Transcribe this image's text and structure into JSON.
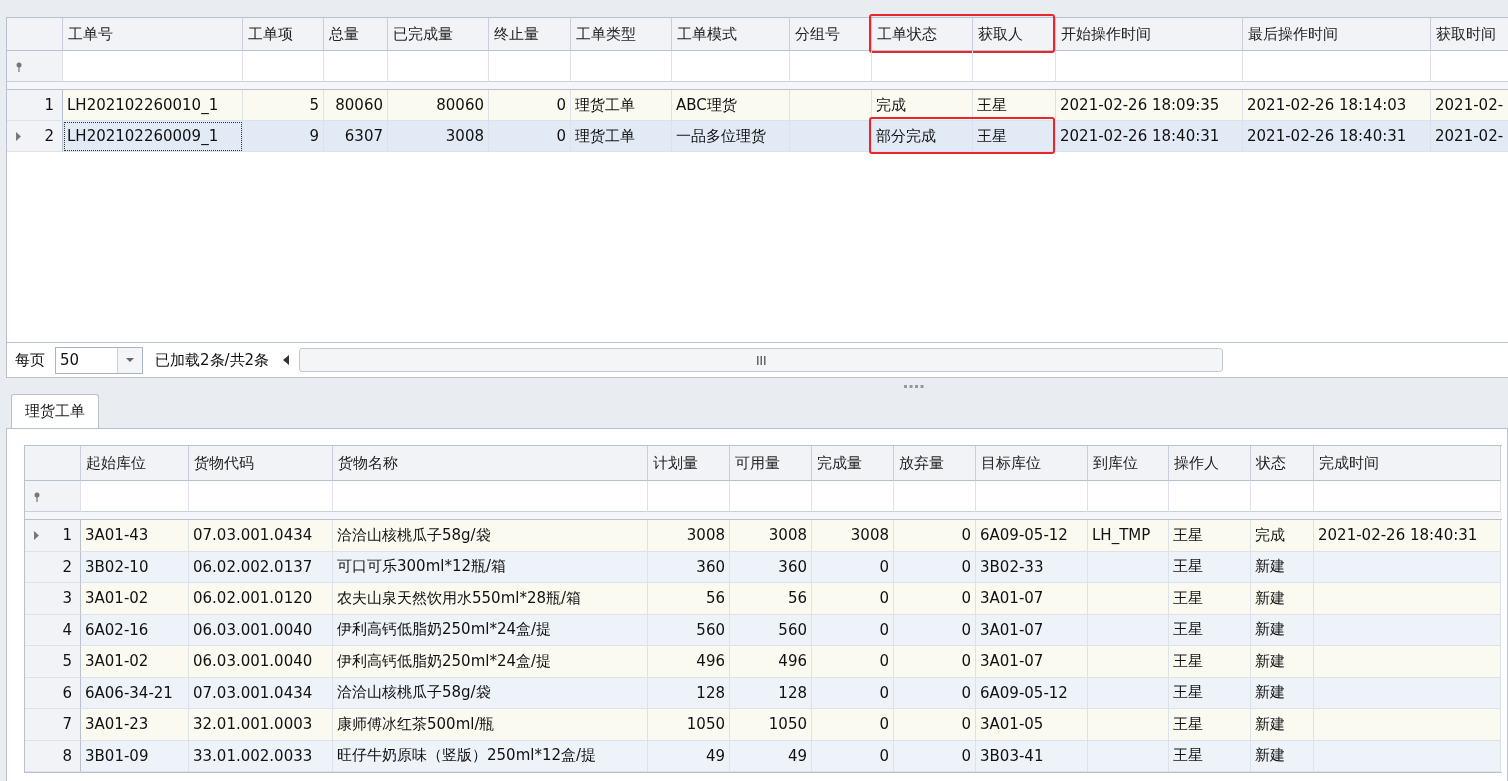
{
  "top_table": {
    "columns": [
      {
        "label": "工单号",
        "kind": "text",
        "highlighted": false
      },
      {
        "label": "工单项",
        "kind": "number",
        "highlighted": false
      },
      {
        "label": "总量",
        "kind": "number",
        "highlighted": false
      },
      {
        "label": "已完成量",
        "kind": "number",
        "highlighted": false
      },
      {
        "label": "终止量",
        "kind": "number",
        "highlighted": false
      },
      {
        "label": "工单类型",
        "kind": "text",
        "highlighted": false
      },
      {
        "label": "工单模式",
        "kind": "text",
        "highlighted": false
      },
      {
        "label": "分组号",
        "kind": "text",
        "highlighted": false
      },
      {
        "label": "工单状态",
        "kind": "text",
        "highlighted": true
      },
      {
        "label": "获取人",
        "kind": "text",
        "highlighted": true
      },
      {
        "label": "开始操作时间",
        "kind": "text",
        "highlighted": false
      },
      {
        "label": "最后操作时间",
        "kind": "text",
        "highlighted": false
      },
      {
        "label": "获取时间",
        "kind": "text",
        "highlighted": false
      }
    ],
    "rows": [
      {
        "index": "1",
        "selected": false,
        "highlighted": false,
        "cells": [
          "LH202102260010_1",
          "5",
          "80060",
          "80060",
          "0",
          "理货工单",
          "ABC理货",
          null,
          "完成",
          "王星",
          "2021-02-26 18:09:35",
          "2021-02-26 18:14:03",
          "2021-02-"
        ]
      },
      {
        "index": "2",
        "selected": true,
        "highlighted": true,
        "cells": [
          "LH202102260009_1",
          "9",
          "6307",
          "3008",
          "0",
          "理货工单",
          "一品多位理货",
          null,
          "部分完成",
          "王星",
          "2021-02-26 18:40:31",
          "2021-02-26 18:40:31",
          "2021-02-"
        ]
      }
    ]
  },
  "pager": {
    "label": "每页",
    "page_size": "50",
    "status": "已加载2条/共2条"
  },
  "tabs": [
    {
      "label": "理货工单",
      "selected": true
    }
  ],
  "bottom_table": {
    "columns": [
      {
        "label": "起始库位",
        "kind": "text"
      },
      {
        "label": "货物代码",
        "kind": "text"
      },
      {
        "label": "货物名称",
        "kind": "text"
      },
      {
        "label": "计划量",
        "kind": "number"
      },
      {
        "label": "可用量",
        "kind": "number"
      },
      {
        "label": "完成量",
        "kind": "number"
      },
      {
        "label": "放弃量",
        "kind": "number"
      },
      {
        "label": "目标库位",
        "kind": "text"
      },
      {
        "label": "到库位",
        "kind": "text"
      },
      {
        "label": "操作人",
        "kind": "text"
      },
      {
        "label": "状态",
        "kind": "text"
      },
      {
        "label": "完成时间",
        "kind": "text"
      }
    ],
    "rows": [
      {
        "index": "1",
        "selected": true,
        "cells": [
          "3A01-43",
          "07.03.001.0434",
          "洽洽山核桃瓜子58g/袋",
          "3008",
          "3008",
          "3008",
          "0",
          "6A09-05-12",
          "LH_TMP",
          "王星",
          "完成",
          "2021-02-26 18:40:31"
        ]
      },
      {
        "index": "2",
        "selected": false,
        "cells": [
          "3B02-10",
          "06.02.002.0137",
          "可口可乐300ml*12瓶/箱",
          "360",
          "360",
          "0",
          "0",
          "3B02-33",
          null,
          "王星",
          "新建",
          null
        ]
      },
      {
        "index": "3",
        "selected": false,
        "cells": [
          "3A01-02",
          "06.02.001.0120",
          "农夫山泉天然饮用水550ml*28瓶/箱",
          "56",
          "56",
          "0",
          "0",
          "3A01-07",
          null,
          "王星",
          "新建",
          null
        ]
      },
      {
        "index": "4",
        "selected": false,
        "cells": [
          "6A02-16",
          "06.03.001.0040",
          "伊利高钙低脂奶250ml*24盒/提",
          "560",
          "560",
          "0",
          "0",
          "3A01-07",
          null,
          "王星",
          "新建",
          null
        ]
      },
      {
        "index": "5",
        "selected": false,
        "cells": [
          "3A01-02",
          "06.03.001.0040",
          "伊利高钙低脂奶250ml*24盒/提",
          "496",
          "496",
          "0",
          "0",
          "3A01-07",
          null,
          "王星",
          "新建",
          null
        ]
      },
      {
        "index": "6",
        "selected": false,
        "cells": [
          "6A06-34-21",
          "07.03.001.0434",
          "洽洽山核桃瓜子58g/袋",
          "128",
          "128",
          "0",
          "0",
          "6A09-05-12",
          null,
          "王星",
          "新建",
          null
        ]
      },
      {
        "index": "7",
        "selected": false,
        "cells": [
          "3A01-23",
          "32.01.001.0003",
          "康师傅冰红茶500ml/瓶",
          "1050",
          "1050",
          "0",
          "0",
          "3A01-05",
          null,
          "王星",
          "新建",
          null
        ]
      },
      {
        "index": "8",
        "selected": false,
        "cells": [
          "3B01-09",
          "33.01.002.0033",
          "旺仔牛奶原味（竖版）250ml*12盒/提",
          "49",
          "49",
          "0",
          "0",
          "3B03-41",
          null,
          "王星",
          "新建",
          null
        ]
      }
    ]
  }
}
